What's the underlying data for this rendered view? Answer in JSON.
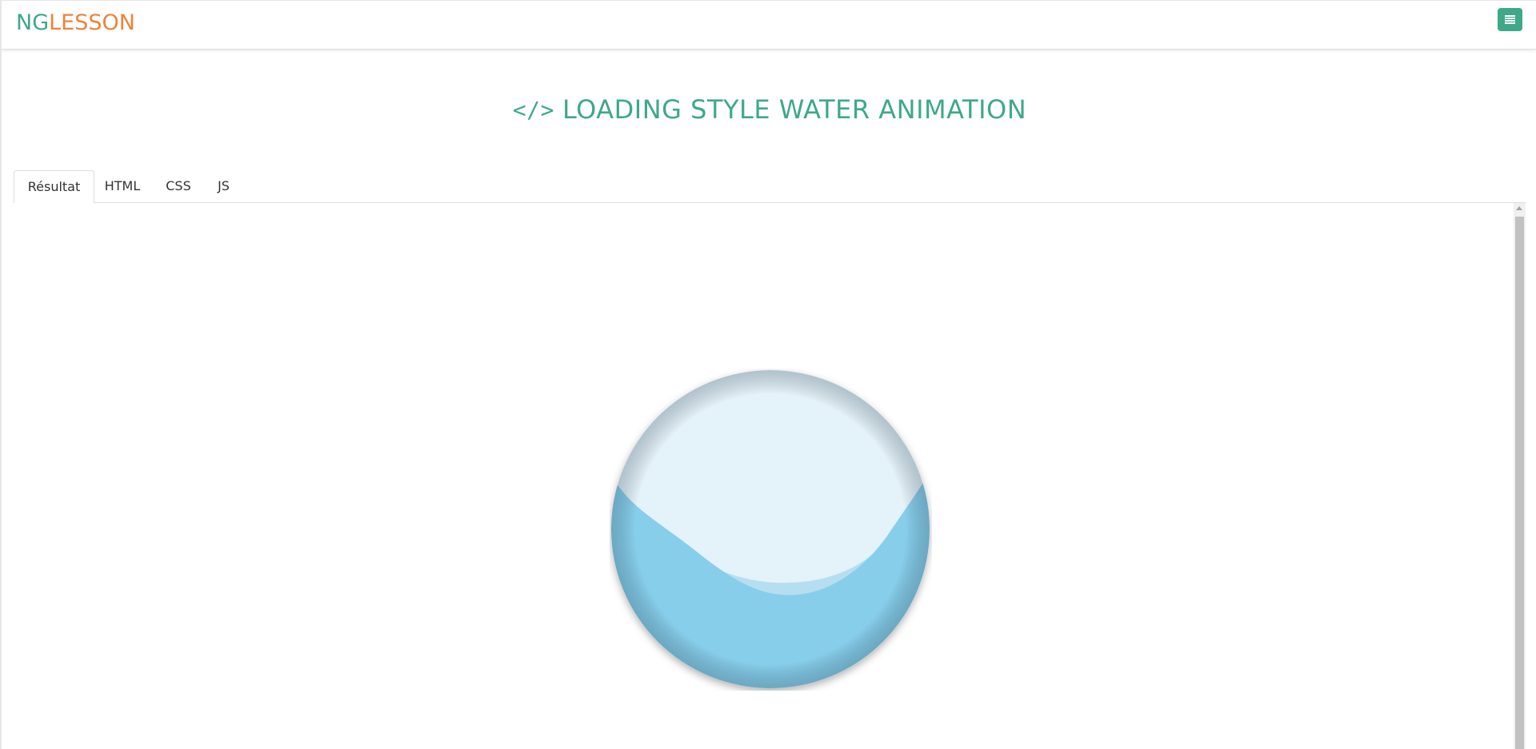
{
  "header": {
    "logo_ng": "NG",
    "logo_lesson": "LESSON",
    "menu_icon": "hamburger-menu-icon",
    "brand_green": "#3fa987",
    "brand_orange": "#f0823a"
  },
  "page": {
    "title": "LOADING STYLE WATER ANIMATION",
    "title_icon": "</>",
    "title_icon_name": "code-icon"
  },
  "tabs": [
    {
      "label": "Résultat",
      "active": true
    },
    {
      "label": "HTML",
      "active": false
    },
    {
      "label": "CSS",
      "active": false
    },
    {
      "label": "JS",
      "active": false
    }
  ],
  "result": {
    "animation": "water-ball-loader",
    "water_color": "#87ceeb",
    "glass_color": "#e4f2f9"
  }
}
